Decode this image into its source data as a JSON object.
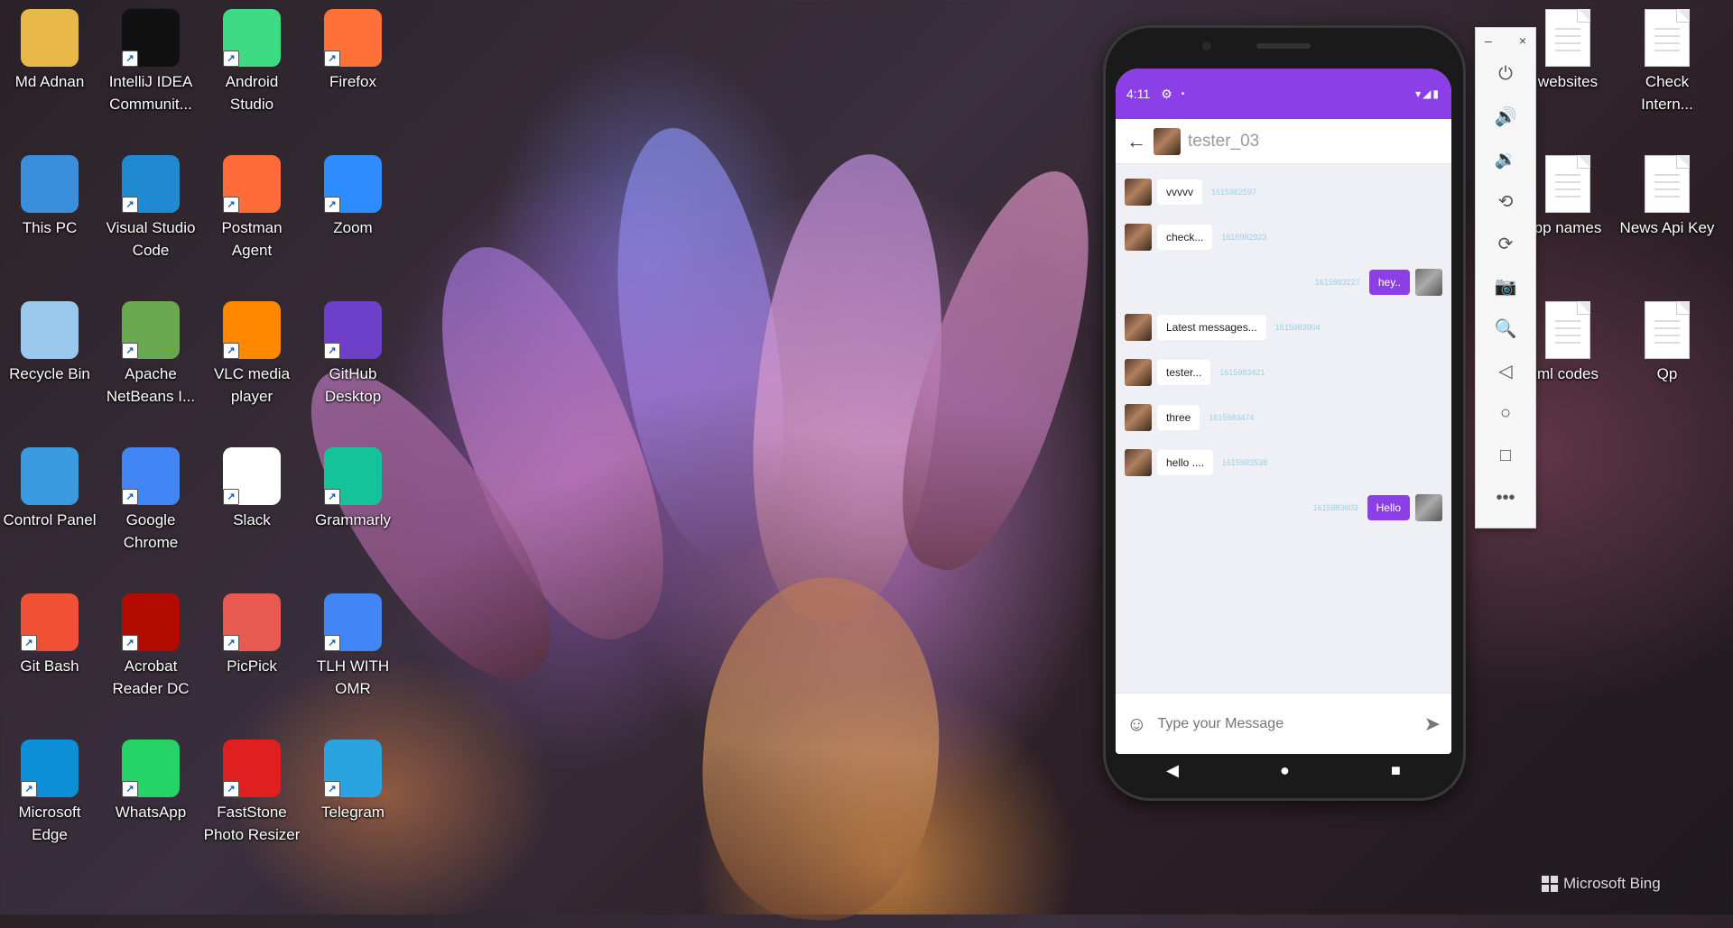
{
  "desktop_icons": [
    {
      "label": "Md Adnan",
      "icon": "user-folder-icon",
      "color": "#e8b84a"
    },
    {
      "label": "IntelliJ IDEA Communit...",
      "icon": "intellij-icon",
      "color": "#111111"
    },
    {
      "label": "Android Studio",
      "icon": "android-studio-icon",
      "color": "#3ddc84"
    },
    {
      "label": "Firefox",
      "icon": "firefox-icon",
      "color": "#ff7139"
    },
    {
      "label": "This PC",
      "icon": "computer-icon",
      "color": "#3b8edc"
    },
    {
      "label": "Visual Studio Code",
      "icon": "vscode-icon",
      "color": "#1f8ad2"
    },
    {
      "label": "Postman Agent",
      "icon": "postman-icon",
      "color": "#ff6c37"
    },
    {
      "label": "Zoom",
      "icon": "zoom-icon",
      "color": "#2d8cff"
    },
    {
      "label": "Recycle Bin",
      "icon": "recycle-bin-icon",
      "color": "#9bc9ee"
    },
    {
      "label": "Apache NetBeans I...",
      "icon": "netbeans-icon",
      "color": "#6aa84f"
    },
    {
      "label": "VLC media player",
      "icon": "vlc-icon",
      "color": "#ff8800"
    },
    {
      "label": "GitHub Desktop",
      "icon": "github-icon",
      "color": "#6e40c9"
    },
    {
      "label": "Control Panel",
      "icon": "control-panel-icon",
      "color": "#3a9be0"
    },
    {
      "label": "Google Chrome",
      "icon": "chrome-icon",
      "color": "#4285f4"
    },
    {
      "label": "Slack",
      "icon": "slack-icon",
      "color": "#ffffff"
    },
    {
      "label": "Grammarly",
      "icon": "grammarly-icon",
      "color": "#15c39a"
    },
    {
      "label": "Git Bash",
      "icon": "git-bash-icon",
      "color": "#f05033"
    },
    {
      "label": "Acrobat Reader DC",
      "icon": "acrobat-icon",
      "color": "#b30b00"
    },
    {
      "label": "PicPick",
      "icon": "picpick-icon",
      "color": "#e85a4f"
    },
    {
      "label": "TLH WITH OMR",
      "icon": "chrome-icon",
      "color": "#4285f4"
    },
    {
      "label": "Microsoft Edge",
      "icon": "edge-icon",
      "color": "#0c8fd6"
    },
    {
      "label": "WhatsApp",
      "icon": "whatsapp-icon",
      "color": "#25d366"
    },
    {
      "label": "FastStone Photo Resizer",
      "icon": "faststone-icon",
      "color": "#e02020"
    },
    {
      "label": "Telegram",
      "icon": "telegram-icon",
      "color": "#2aa3de"
    }
  ],
  "right_icons": [
    {
      "label": "websites",
      "icon": "document-icon"
    },
    {
      "label": "Check Intern...",
      "icon": "document-icon"
    },
    {
      "label": "pp names",
      "icon": "document-icon"
    },
    {
      "label": "News Api Key",
      "icon": "document-icon"
    },
    {
      "label": "ml codes",
      "icon": "document-icon"
    },
    {
      "label": "Qp",
      "icon": "document-icon"
    }
  ],
  "phone": {
    "status_time": "4:11",
    "status_settings": "⚙",
    "status_dot": "•",
    "status_right": "▾◢▮",
    "chat_title": "tester_03",
    "back_icon": "←",
    "messages": [
      {
        "dir": "in",
        "text": "vvvvv",
        "time": "1615982597"
      },
      {
        "dir": "in",
        "text": "check...",
        "time": "1615982923"
      },
      {
        "dir": "out",
        "text": "hey..",
        "time": "1615983227"
      },
      {
        "dir": "in",
        "text": "Latest messages...",
        "time": "1615983904"
      },
      {
        "dir": "in",
        "text": "tester...",
        "time": "1615983421"
      },
      {
        "dir": "in",
        "text": "three",
        "time": "1615983474"
      },
      {
        "dir": "in",
        "text": "hello ....",
        "time": "1615983538"
      },
      {
        "dir": "out",
        "text": "Hello",
        "time": "1615983603"
      }
    ],
    "composer_placeholder": "Type your Message",
    "smile_icon": "☺",
    "send_icon": "➤",
    "nav_back": "◀",
    "nav_home": "●",
    "nav_recents": "■",
    "accent": "#8c3fe6"
  },
  "emulator_controls": {
    "minimize": "–",
    "close": "×",
    "buttons": [
      {
        "name": "power-button",
        "glyph": "⏻"
      },
      {
        "name": "volume-up-button",
        "glyph": "🔊"
      },
      {
        "name": "volume-down-button",
        "glyph": "🔉"
      },
      {
        "name": "rotate-left-button",
        "glyph": "⟲"
      },
      {
        "name": "rotate-right-button",
        "glyph": "⟳"
      },
      {
        "name": "screenshot-button",
        "glyph": "📷"
      },
      {
        "name": "zoom-button",
        "glyph": "🔍"
      },
      {
        "name": "back-button",
        "glyph": "◁"
      },
      {
        "name": "home-button",
        "glyph": "○"
      },
      {
        "name": "overview-button",
        "glyph": "□"
      },
      {
        "name": "more-button",
        "glyph": "•••"
      }
    ]
  },
  "watermark": "Microsoft Bing"
}
